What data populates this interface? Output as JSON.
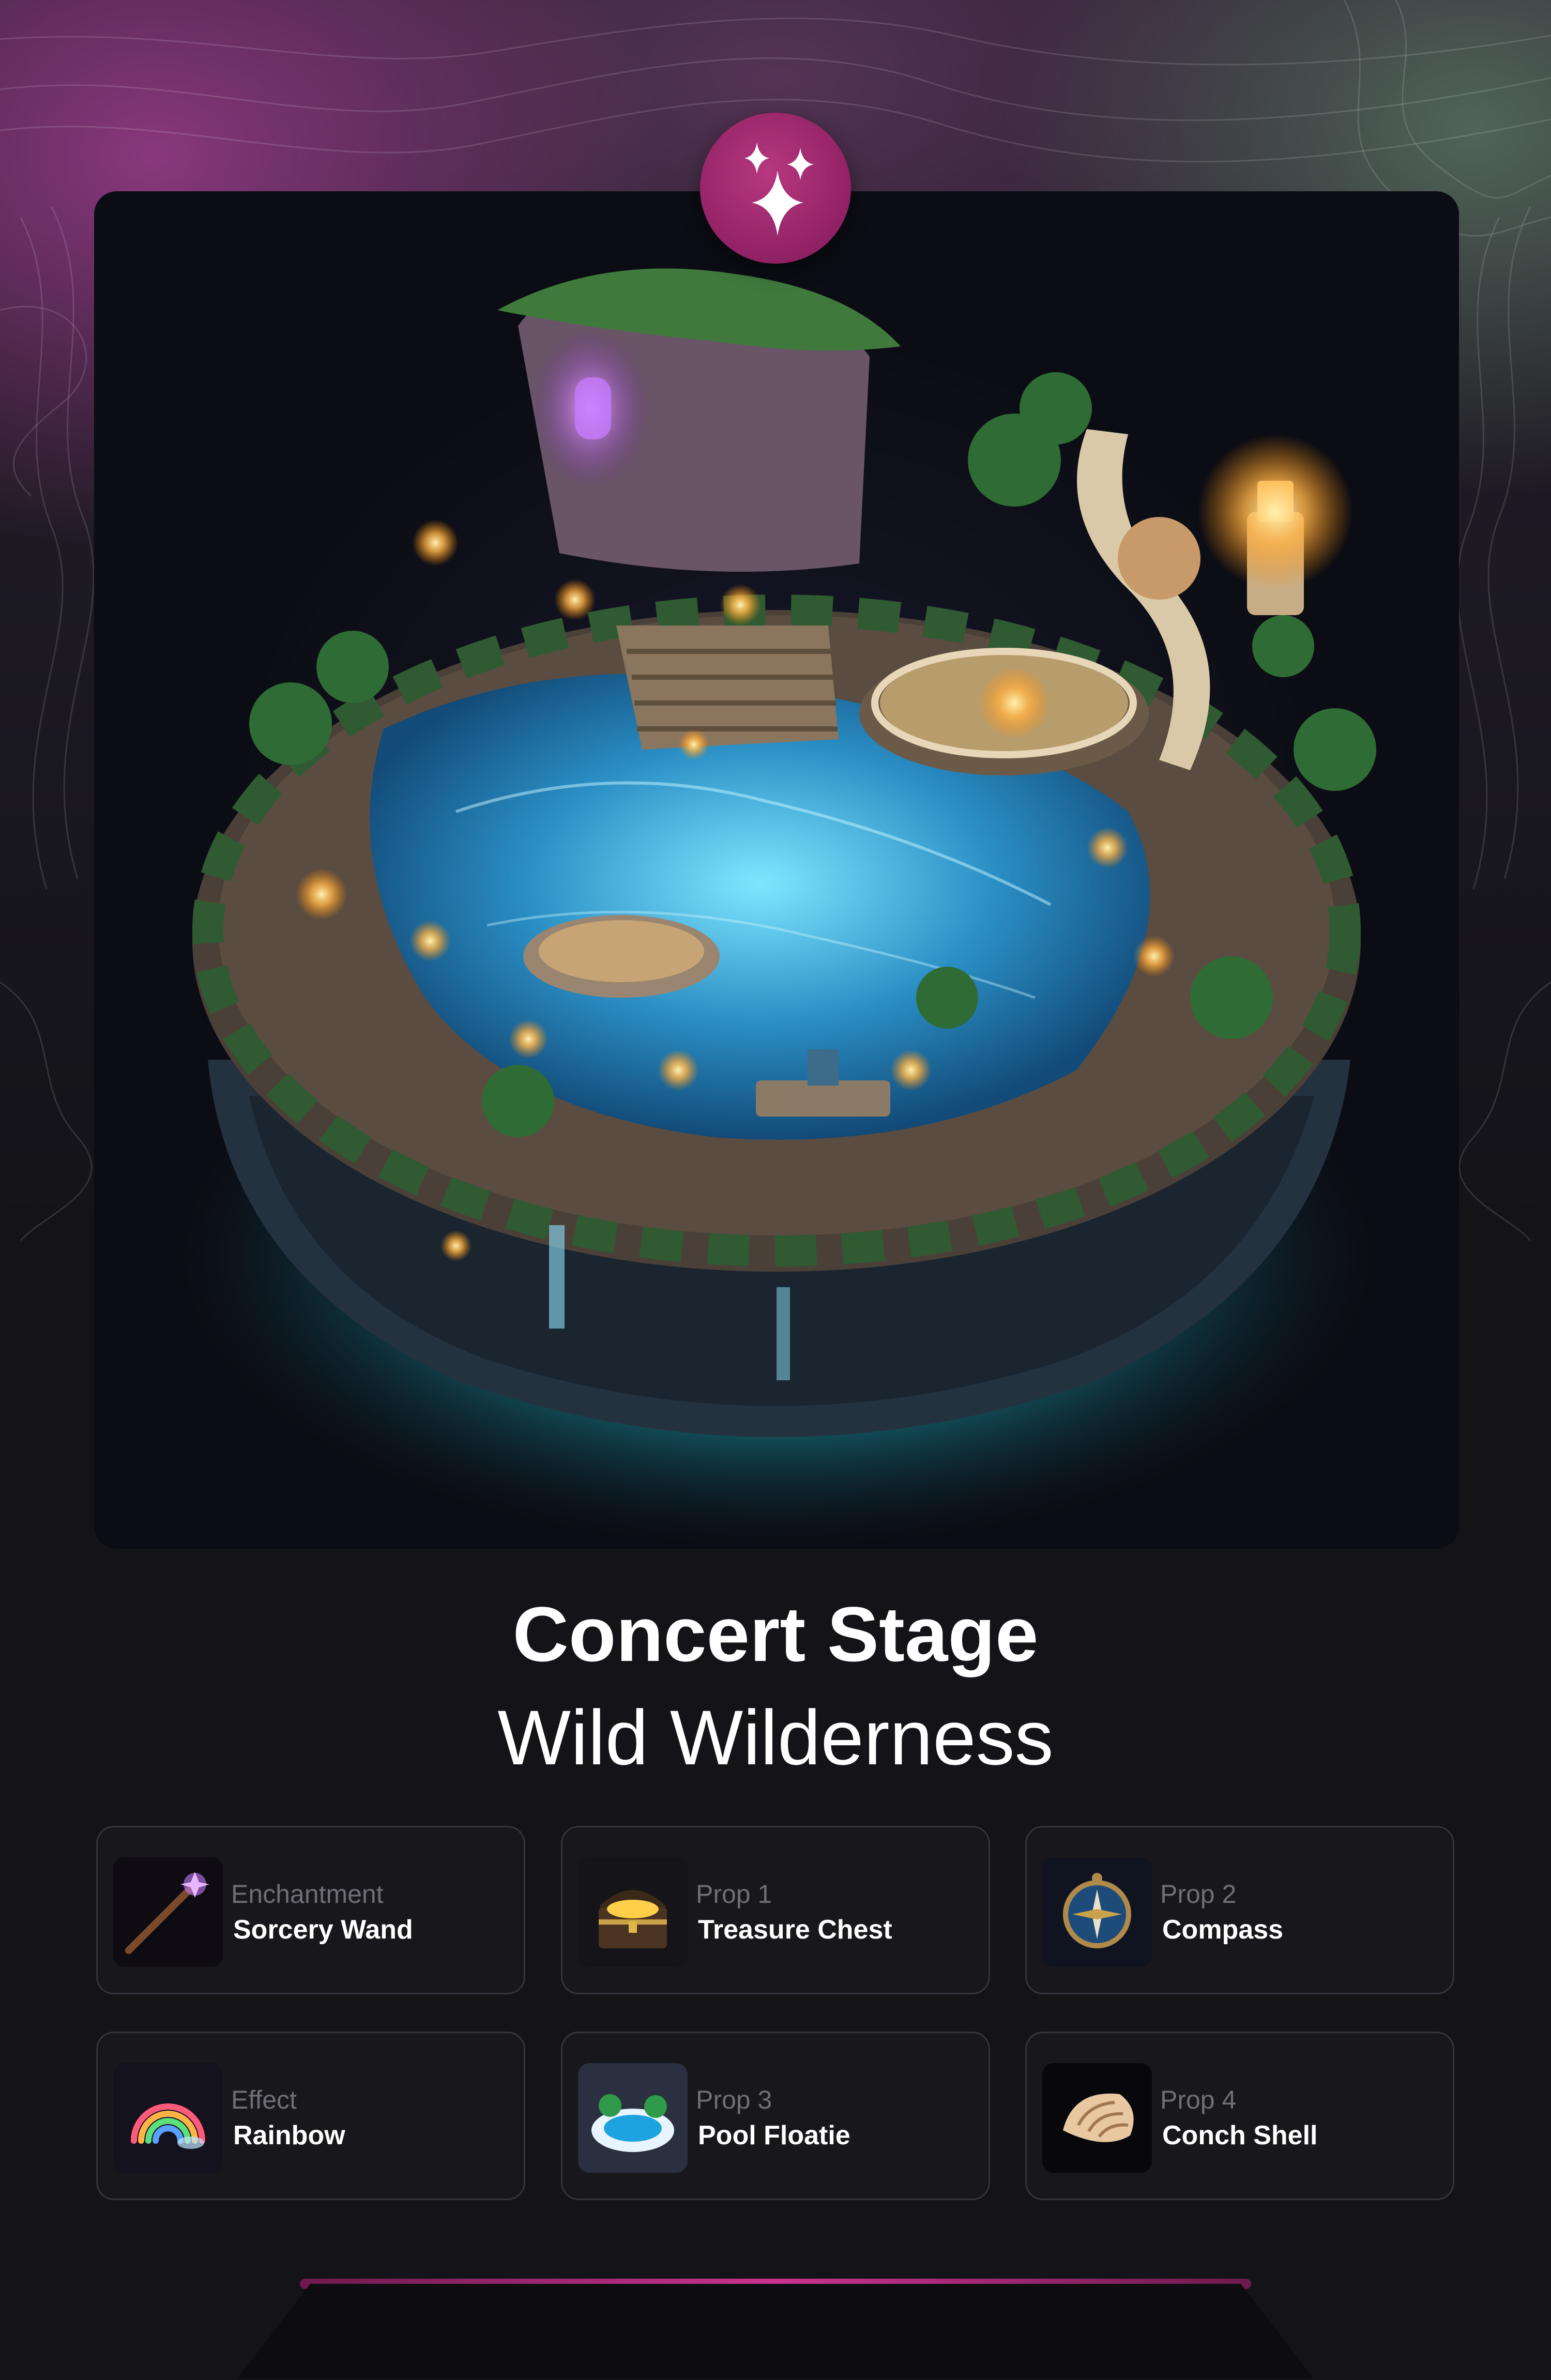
{
  "stage": {
    "title": "Concert Stage",
    "subtitle": "Wild Wilderness",
    "badge_icon": "sparkles-icon"
  },
  "items": [
    {
      "category": "Enchantment",
      "name": "Sorcery Wand",
      "icon": "sorcery-wand-icon"
    },
    {
      "category": "Prop 1",
      "name": "Treasure Chest",
      "icon": "treasure-chest-icon"
    },
    {
      "category": "Prop 2",
      "name": "Compass",
      "icon": "compass-icon"
    },
    {
      "category": "Effect",
      "name": "Rainbow",
      "icon": "rainbow-icon"
    },
    {
      "category": "Prop 3",
      "name": "Pool Floatie",
      "icon": "pool-floatie-icon"
    },
    {
      "category": "Prop 4",
      "name": "Conch Shell",
      "icon": "conch-shell-icon"
    }
  ],
  "colors": {
    "accent": "#b03078",
    "background": "#131318",
    "card_border": "#34343c",
    "muted_text": "#6f6f77",
    "glow": "#3fe0e6"
  }
}
